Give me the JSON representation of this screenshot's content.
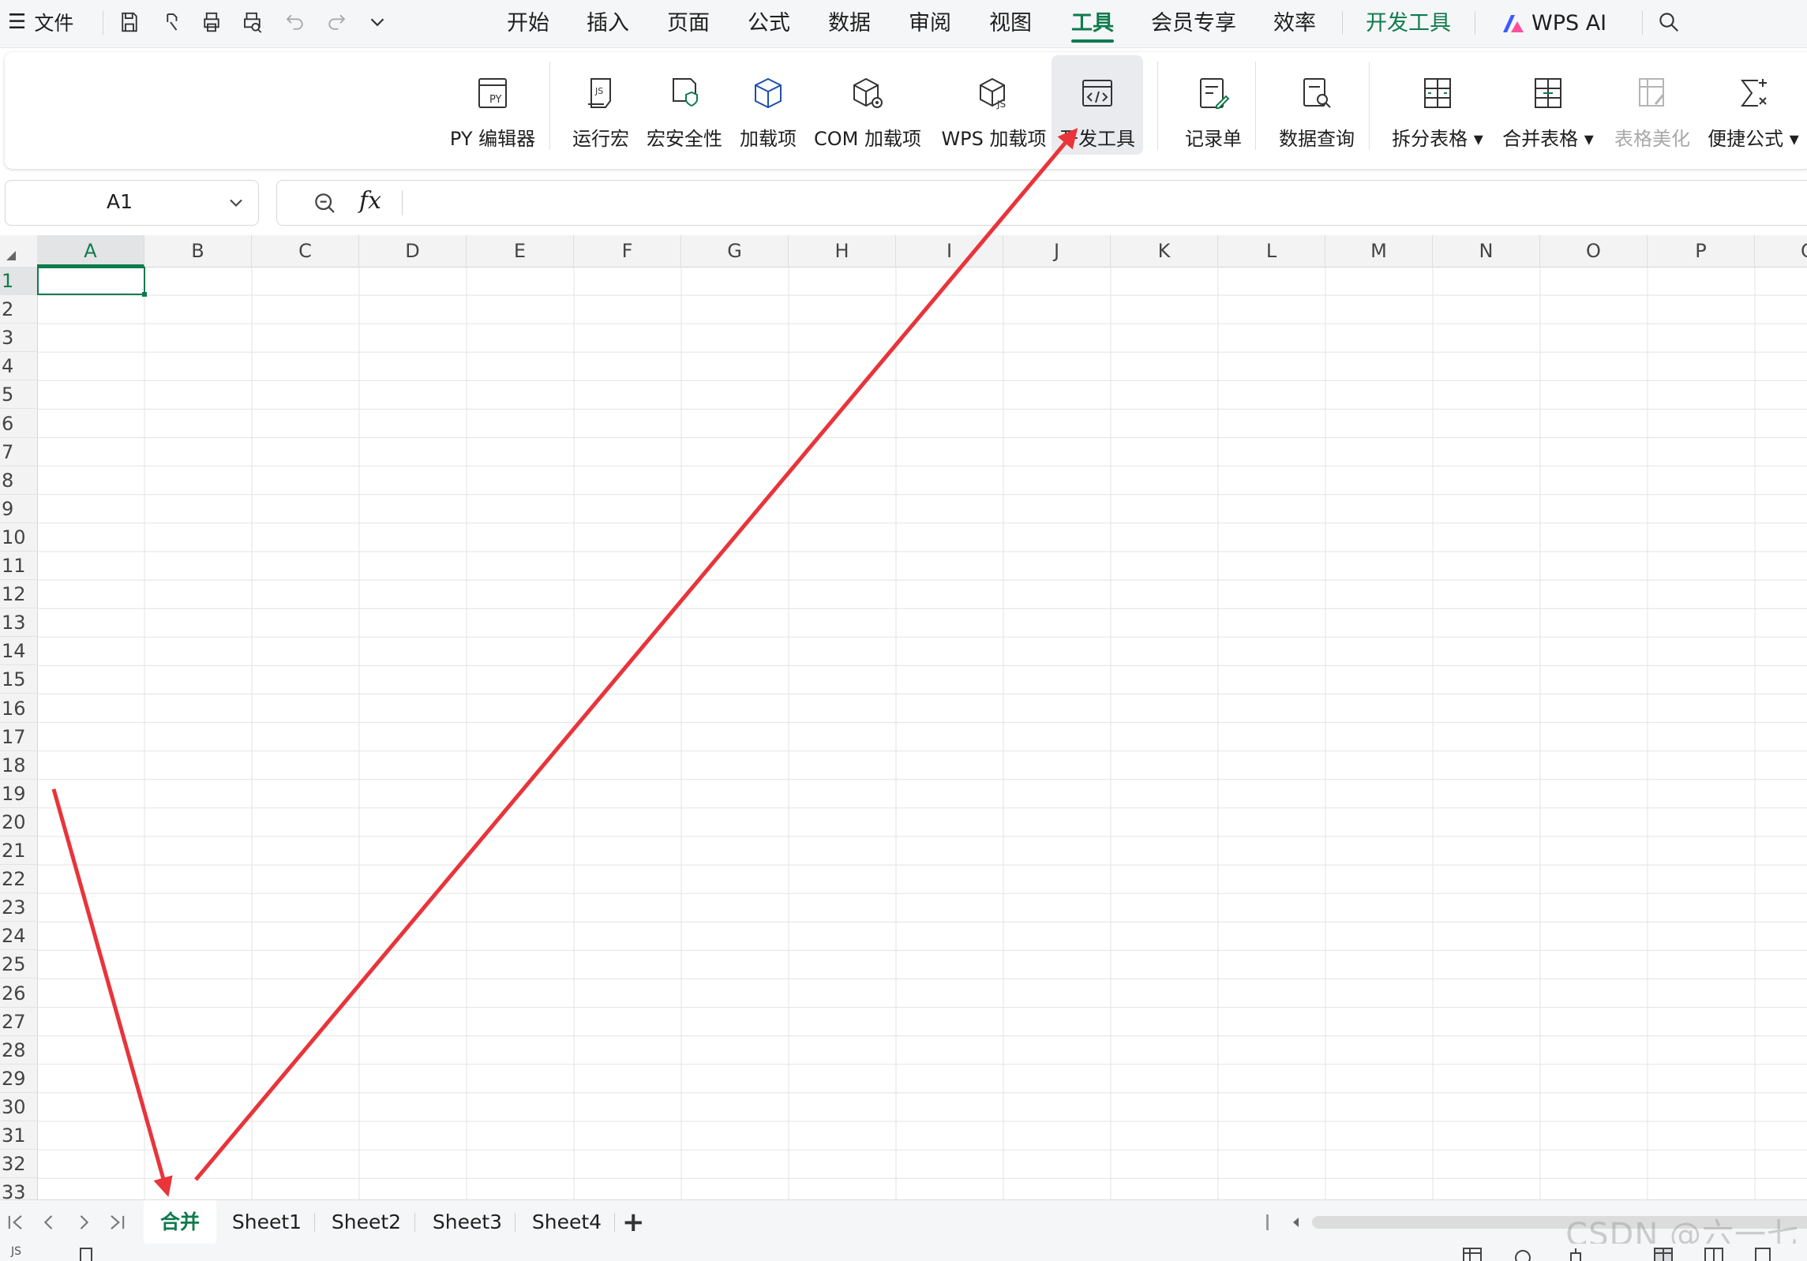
{
  "menubar": {
    "file_label": "文件",
    "tabs": [
      "开始",
      "插入",
      "页面",
      "公式",
      "数据",
      "审阅",
      "视图",
      "工具",
      "会员专享",
      "效率",
      "开发工具",
      "WPS AI"
    ],
    "active_tab": "工具"
  },
  "ribbon": {
    "buttons": [
      "PY 编辑器",
      "运行宏",
      "宏安全性",
      "加载项",
      "COM 加载项",
      "WPS 加载项",
      "开发工具",
      "记录单",
      "数据查询",
      "拆分表格",
      "合并表格",
      "表格美化",
      "便捷公式"
    ],
    "highlighted": "开发工具",
    "disabled": "表格美化"
  },
  "formula_bar": {
    "name_box": "A1",
    "fx_label": "fx",
    "formula": ""
  },
  "grid": {
    "columns": [
      "A",
      "B",
      "C",
      "D",
      "E",
      "F",
      "G",
      "H",
      "I",
      "J",
      "K",
      "L",
      "M",
      "N",
      "O",
      "P",
      "Q"
    ],
    "rows": [
      "1",
      "2",
      "3",
      "4",
      "5",
      "6",
      "7",
      "8",
      "9",
      "10",
      "11",
      "12",
      "13",
      "14",
      "15",
      "16",
      "17",
      "18",
      "19",
      "20",
      "21",
      "22",
      "23",
      "24",
      "25",
      "26",
      "27",
      "28",
      "29",
      "30",
      "31",
      "32",
      "33"
    ],
    "selected_cell": "A1"
  },
  "sheets": {
    "tabs": [
      "合并",
      "Sheet1",
      "Sheet2",
      "Sheet3",
      "Sheet4"
    ],
    "active": "合并",
    "add_label": "+"
  },
  "status": {
    "js_label": "JS"
  },
  "watermark": "CSDN @六一七",
  "colors": {
    "accent": "#0f7b4d",
    "arrow": "#e8343a"
  }
}
